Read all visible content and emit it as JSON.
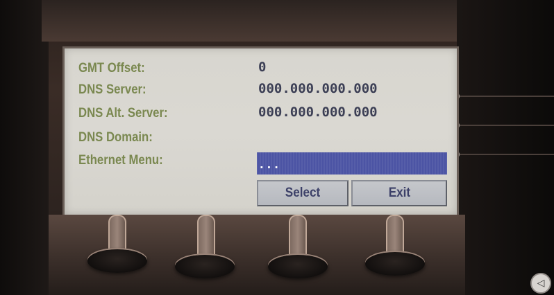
{
  "screen": {
    "rows": [
      {
        "label": "GMT Offset:",
        "value": "0"
      },
      {
        "label": "DNS Server:",
        "value": "000.000.000.000"
      },
      {
        "label": "DNS Alt. Server:",
        "value": "000.000.000.000"
      },
      {
        "label": "DNS Domain:",
        "value": ""
      },
      {
        "label": "Ethernet Menu:",
        "value": "..."
      }
    ],
    "softkeys": {
      "select_label": "Select",
      "exit_label": "Exit"
    }
  },
  "colors": {
    "label": "#7a8850",
    "value": "#3c3f55",
    "highlight": "#4c54a4",
    "lcd_background": "#d8d6cf",
    "softkey_background": "#c0c3c8"
  },
  "icons": {
    "nav_left": "left-triangle-icon"
  }
}
